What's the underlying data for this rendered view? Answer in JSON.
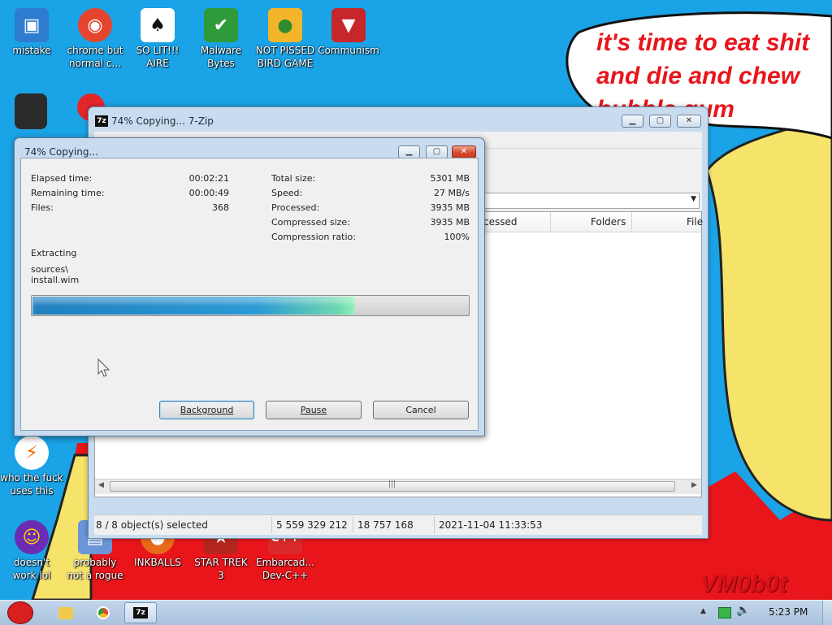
{
  "desktop": {
    "sign_lines": [
      "it's time to eat shit",
      "and die and chew",
      "bubble gum"
    ],
    "watermark": "VM0b0t",
    "icons": [
      {
        "label": "mistake",
        "color": "#2f7dd1",
        "glyph": "▣"
      },
      {
        "label": "chrome but\nnormal c...",
        "color": "#e5452f",
        "glyph": "◉"
      },
      {
        "label": "SO LIT!!!\nAIRE",
        "color": "#ffffff",
        "glyph": "♠"
      },
      {
        "label": "Malware\nBytes",
        "color": "#2e9a3a",
        "glyph": "✔"
      },
      {
        "label": "NOT PISSED\nBIRD GAME",
        "color": "#f3b62a",
        "glyph": "●"
      },
      {
        "label": "Communism",
        "color": "#c7262b",
        "glyph": "▼"
      },
      {
        "label": "who the fuck\nuses this",
        "color": "#ffffff",
        "glyph": "⚡"
      },
      {
        "label": "doesn't\nwork lol",
        "color": "#6c2bb3",
        "glyph": "☺"
      },
      {
        "label": "probably\nnot a rogue",
        "color": "#6a95d8",
        "glyph": "▤"
      },
      {
        "label": "INKBALLS",
        "color": "#e76a1b",
        "glyph": "●"
      },
      {
        "label": "STAR TREK\n3",
        "color": "#b3261e",
        "glyph": "★"
      },
      {
        "label": "Embarcad...\nDev-C++",
        "color": "#d92a2a",
        "glyph": "C++"
      }
    ]
  },
  "zip_window": {
    "title": "74% Copying... 7-Zip",
    "app_icon": "7z",
    "columns": [
      "cessed",
      "Folders",
      "File"
    ],
    "status": {
      "selected": "8 / 8 object(s) selected",
      "size": "5 559 329 212",
      "packed": "18 757 168",
      "modified": "2021-11-04 11:33:53"
    }
  },
  "progress_dialog": {
    "title": "74% Copying...",
    "left_stats": [
      {
        "label": "Elapsed time:",
        "value": "00:02:21"
      },
      {
        "label": "Remaining time:",
        "value": "00:00:49"
      },
      {
        "label": "Files:",
        "value": "368"
      }
    ],
    "right_stats": [
      {
        "label": "Total size:",
        "value": "5301 MB"
      },
      {
        "label": "Speed:",
        "value": "27 MB/s"
      },
      {
        "label": "Processed:",
        "value": "3935 MB"
      },
      {
        "label": "Compressed size:",
        "value": "3935 MB"
      },
      {
        "label": "Compression ratio:",
        "value": "100%"
      }
    ],
    "operation": "Extracting",
    "current_path": "sources\\",
    "current_file": "install.wim",
    "progress_fraction": 0.74,
    "buttons": {
      "background": "Background",
      "pause": "Pause",
      "cancel": "Cancel"
    }
  },
  "taskbar": {
    "clock": "5:23 PM",
    "active_item": "7z"
  }
}
